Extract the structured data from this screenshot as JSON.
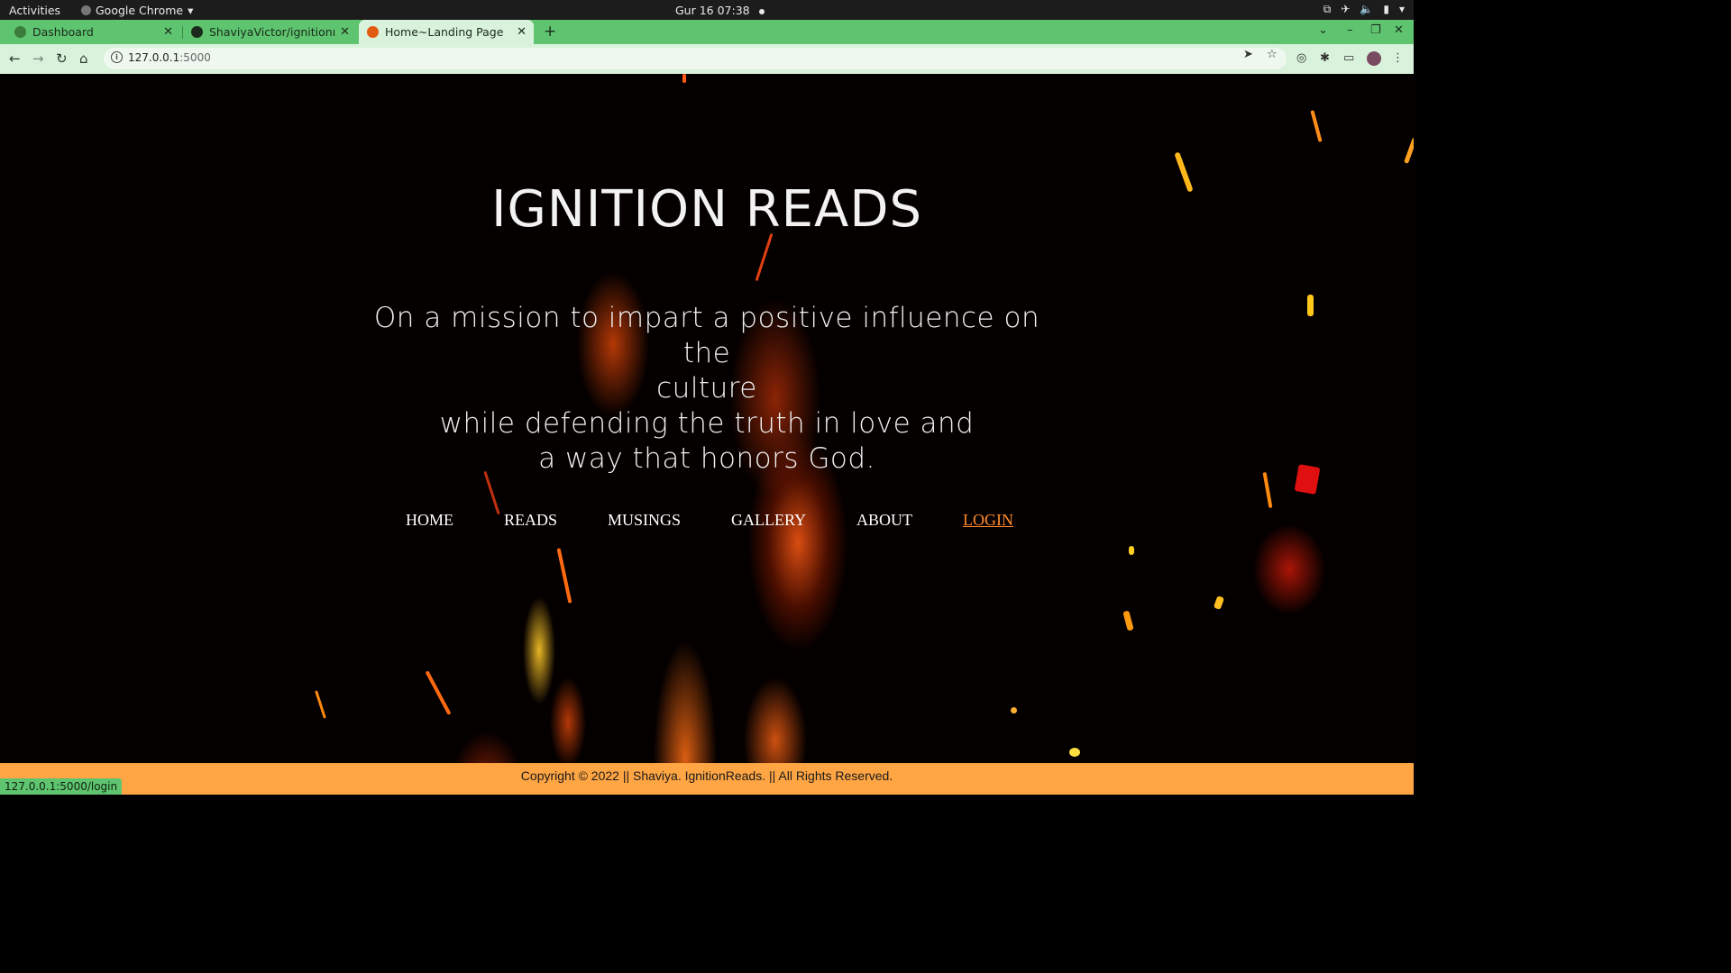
{
  "system_bar": {
    "activities": "Activities",
    "app_name": "Google Chrome",
    "clock": "Gur 16  07:38"
  },
  "browser": {
    "tabs": [
      {
        "title": "Dashboard",
        "active": false
      },
      {
        "title": "ShaviyaVictor/ignitionre",
        "active": false
      },
      {
        "title": "Home~Landing Page",
        "active": true
      }
    ],
    "url_host": "127.0.0.1",
    "url_port": ":5000",
    "status_url": "127.0.0.1:5000/login",
    "colors": {
      "tab_strip": "#5ec46f",
      "toolbar": "#d9f2dc"
    }
  },
  "page": {
    "brand": "IGNITION READS",
    "mission_lines": [
      "On a mission to impart a positive influence on the",
      "culture",
      "while defending the truth in love and",
      "a way that honors God."
    ],
    "nav": {
      "home": "HOME",
      "reads": "READS",
      "musings": "MUSINGS",
      "gallery": "GALLERY",
      "about": "ABOUT",
      "login": "LOGIN"
    },
    "footer": "Copyright © 2022 || Shaviya. IgnitionReads. || All Rights Reserved.",
    "colors": {
      "footer_bg": "#ffa544",
      "login_link": "#ff8a2a"
    }
  }
}
